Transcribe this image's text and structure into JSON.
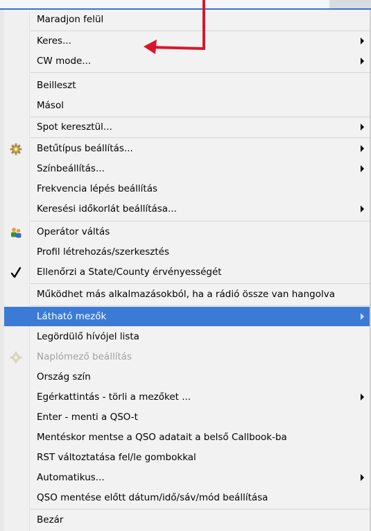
{
  "menu": {
    "items": [
      {
        "label": "Maradjon felül",
        "arrow": false
      },
      {
        "label": "Keres...",
        "arrow": true
      },
      {
        "label": "CW mode...",
        "arrow": true
      },
      {
        "label": "Beilleszt",
        "arrow": false
      },
      {
        "label": "Másol",
        "arrow": false
      },
      {
        "label": "Spot keresztül...",
        "arrow": true
      },
      {
        "label": "Betűtípus beállítás...",
        "arrow": true,
        "icon": "gear-icon"
      },
      {
        "label": "Színbeállítás...",
        "arrow": true
      },
      {
        "label": "Frekvencia lépés beállítás",
        "arrow": false
      },
      {
        "label": "Keresési időkorlát beállítása...",
        "arrow": true
      },
      {
        "label": "Operátor váltás",
        "arrow": false,
        "icon": "users-icon"
      },
      {
        "label": "Profil létrehozás/szerkesztés",
        "arrow": false
      },
      {
        "label": "Ellenőrzi a State/County érvényességét",
        "arrow": false,
        "icon": "checkmark-icon",
        "checked": true
      },
      {
        "label": "Működhet más alkalmazásokból, ha a rádió össze van hangolva",
        "arrow": false
      },
      {
        "label": "Látható mezők",
        "arrow": true,
        "highlighted": true
      },
      {
        "label": "Legördülő hívójel lista",
        "arrow": false
      },
      {
        "label": "Naplómező beállítás",
        "arrow": false,
        "icon": "gear-icon",
        "disabled": true
      },
      {
        "label": "Ország szín",
        "arrow": false
      },
      {
        "label": "Egérkattintás - törli a mezőket ...",
        "arrow": true
      },
      {
        "label": "Enter - menti a QSO-t",
        "arrow": false
      },
      {
        "label": "Mentéskor mentse a QSO adatait a belső Callbook-ba",
        "arrow": false
      },
      {
        "label": "RST változtatása fel/le gombokkal",
        "arrow": false
      },
      {
        "label": "Automatikus...",
        "arrow": true
      },
      {
        "label": "QSO mentése előtt dátum/idő/sáv/mód beállítása",
        "arrow": false
      },
      {
        "label": "Bezár",
        "arrow": false
      }
    ]
  },
  "colors": {
    "highlight": "#3b7bd6",
    "annotation": "#d9162b"
  }
}
